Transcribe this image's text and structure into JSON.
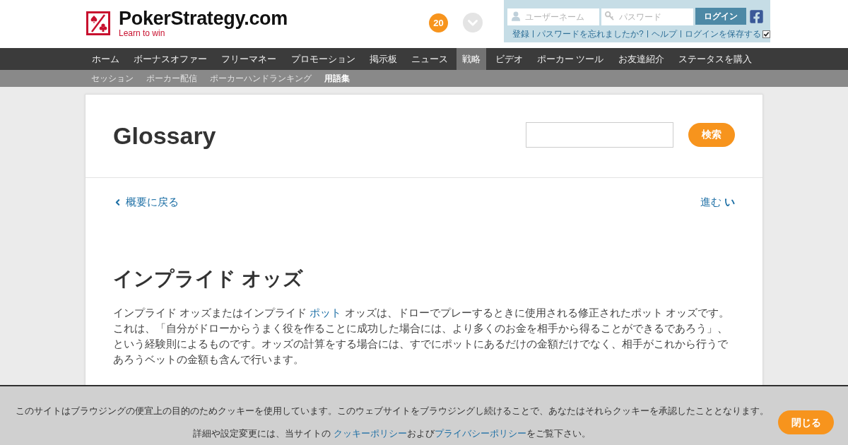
{
  "header": {
    "logo": {
      "title": "PokerStrategy.com",
      "tagline": "Learn to win"
    },
    "notification_count": "20",
    "login": {
      "username_placeholder": "ユーザーネーム",
      "password_placeholder": "パスワード",
      "button": "ログイン",
      "links": [
        "登録",
        "パスワードを忘れましたか?",
        "ヘルプ"
      ],
      "remember": {
        "label": "ログインを保存する",
        "checked": true
      }
    }
  },
  "nav": {
    "items": [
      {
        "label": "ホーム",
        "selected": false
      },
      {
        "label": "ボーナスオファー",
        "selected": false
      },
      {
        "label": "フリーマネー",
        "selected": false
      },
      {
        "label": "プロモーション",
        "selected": false
      },
      {
        "label": "掲示板",
        "selected": false
      },
      {
        "label": "ニュース",
        "selected": false
      },
      {
        "label": "戦略",
        "selected": true
      },
      {
        "label": "ビデオ",
        "selected": false
      },
      {
        "label": "ポーカー ツール",
        "selected": false
      },
      {
        "label": "お友達紹介",
        "selected": false
      },
      {
        "label": "ステータスを購入",
        "selected": false
      }
    ]
  },
  "subnav": {
    "items": [
      {
        "label": "セッション",
        "selected": false
      },
      {
        "label": "ポーカー配信",
        "selected": false
      },
      {
        "label": "ポーカーハンドランキング",
        "selected": false
      },
      {
        "label": "用語集",
        "selected": true
      }
    ]
  },
  "page": {
    "title": "Glossary",
    "search": {
      "button": "検索"
    },
    "back_link": "概要に戻る",
    "next_link": "進む **い**",
    "entry": {
      "heading": "インプライド オッズ",
      "body": [
        {
          "kind": "text",
          "text": "インプライド オッズまたはインプライド "
        },
        {
          "kind": "link",
          "text": "ポット"
        },
        {
          "kind": "text",
          "text": " オッズは、ドローでプレーするときに使用される修正されたポット オッズです。これは、「自分がドローからうまく役を作ることに成功した場合には、より多くのお金を相手から得ることができるであろう」、という経験則によるものです。オッズの計算をする場合には、すでにポットにあるだけの金額だけでなく、相手がこれから行うであろうベットの金額も含んで行います。"
        }
      ]
    }
  },
  "cookie_banner": {
    "text": [
      {
        "kind": "text",
        "text": "このサイトはブラウジングの便宜上の目的のためクッキーを使用しています。このウェブサイトをブラウジングし続けることで、あなたはそれらクッキーを承認したこととなります。詳細や設定変更には、当サイトの "
      },
      {
        "kind": "link",
        "text": "クッキーポリシー"
      },
      {
        "kind": "text",
        "text": "および"
      },
      {
        "kind": "link",
        "text": "プライバシーポリシー"
      },
      {
        "kind": "text",
        "text": "をご覧下さい。"
      }
    ],
    "button": "閉じる"
  }
}
